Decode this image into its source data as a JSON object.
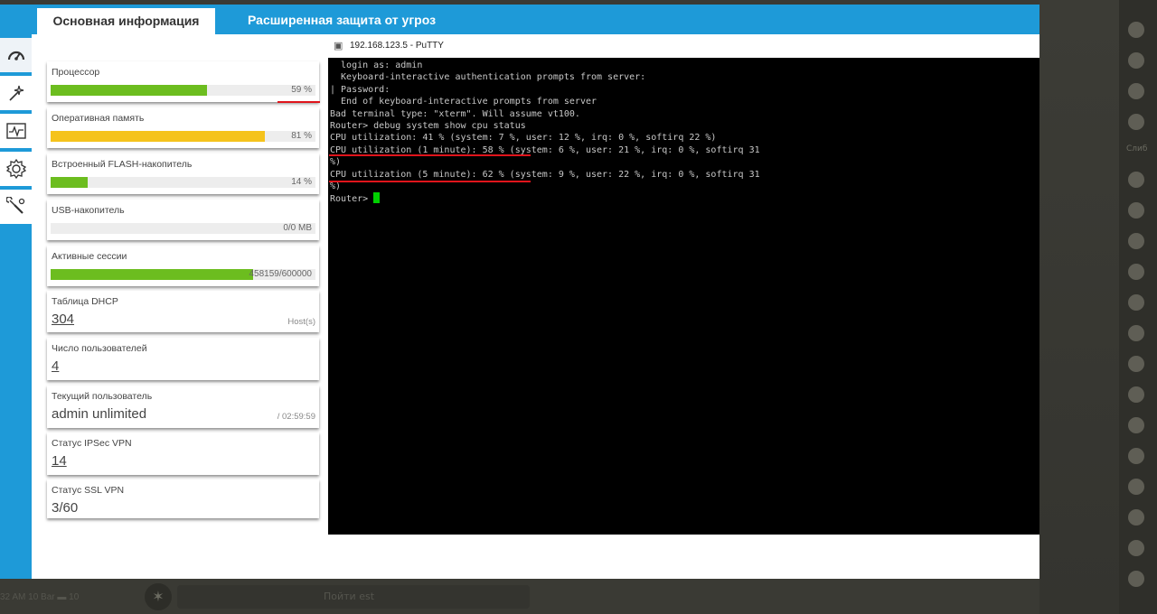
{
  "tabs": {
    "main": "Основная информация",
    "threat": "Расширенная защита от угроз"
  },
  "sidebar": {
    "icons": [
      "speedometer-icon",
      "magic-wand-icon",
      "pulse-monitor-icon",
      "gear-icon",
      "tools-icon"
    ]
  },
  "widgets": {
    "cpu": {
      "label": "Процессор",
      "value": "59 %",
      "fill": 0.59,
      "color": "#6cbd1f"
    },
    "ram": {
      "label": "Оперативная память",
      "value": "81 %",
      "fill": 0.81,
      "color": "#f5c31c"
    },
    "flash": {
      "label": "Встроенный FLASH-накопитель",
      "value": "14 %",
      "fill": 0.14,
      "color": "#6cbd1f"
    },
    "usb": {
      "label": "USB-накопитель",
      "value": "0/0 MB",
      "fill": 0.0,
      "color": "#6cbd1f"
    },
    "sessions": {
      "label": "Активные сессии",
      "value": "458159/600000",
      "fill": 0.764,
      "color": "#6cbd1f"
    },
    "dhcp": {
      "label": "Таблица DHCP",
      "value": "304",
      "unit": "Host(s)"
    },
    "users": {
      "label": "Число пользователей",
      "value": "4"
    },
    "current_user": {
      "label": "Текущий пользователь",
      "value": "admin unlimited",
      "unit": "/ 02:59:59"
    },
    "ipsec": {
      "label": "Статус IPSec VPN",
      "value": "14"
    },
    "ssl": {
      "label": "Статус SSL VPN",
      "value": "3/60"
    }
  },
  "putty": {
    "title": "192.168.123.5 - PuTTY",
    "lines": [
      "  login as: admin",
      "  Keyboard-interactive authentication prompts from server:",
      "| Password:",
      "  End of keyboard-interactive prompts from server",
      "Bad terminal type: \"xterm\". Will assume vt100.",
      "Router> debug system show cpu status",
      "CPU utilization: 41 % (system: 7 %, user: 12 %, irq: 0 %, softirq 22 %)",
      "CPU utilization (1 minute): 58 % (system: 6 %, user: 21 %, irq: 0 %, softirq 31",
      "%)",
      "CPU utilization (5 minute): 62 % (system: 9 %, user: 22 %, irq: 0 %, softirq 31",
      "%)",
      "Router> "
    ]
  },
  "background": {
    "right_label": "Слиб",
    "bottom_left": "32 AM 10 Bar ▬ 10",
    "bottom_bar_text": "Пойти est"
  }
}
